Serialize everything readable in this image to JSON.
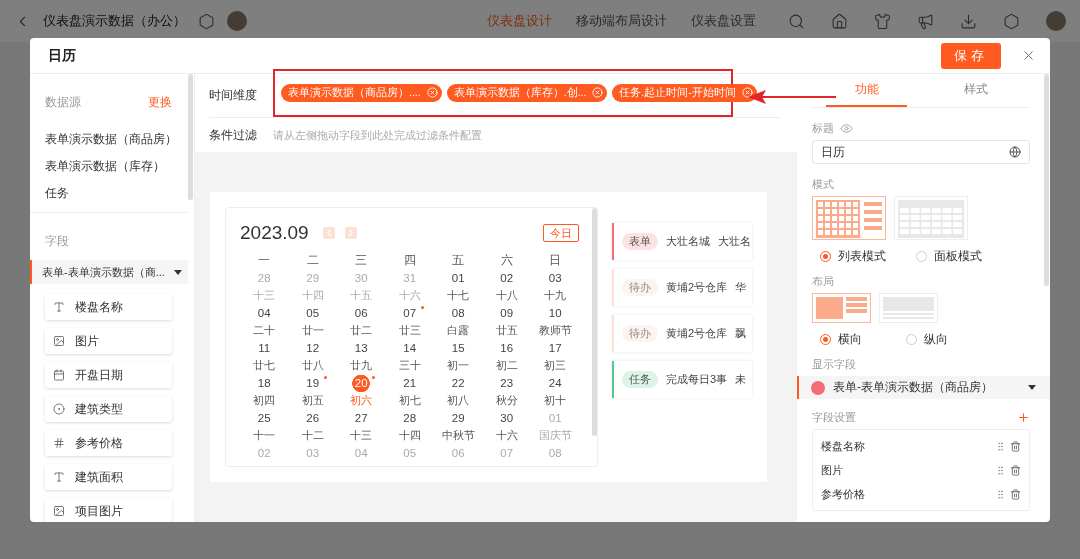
{
  "top_bar": {
    "title": "仪表盘演示数据（办公）",
    "tabs": [
      {
        "label": "仪表盘设计",
        "selected": true
      },
      {
        "label": "移动端布局设计",
        "selected": false
      },
      {
        "label": "仪表盘设置",
        "selected": false
      }
    ]
  },
  "dialog": {
    "title": "日历",
    "save": "保存",
    "left": {
      "source_label": "数据源",
      "change_link": "更换",
      "sources": [
        "表单演示数据（商品房）",
        "表单演示数据（库存）",
        "任务"
      ],
      "field_label": "字段",
      "group": "表单-表单演示数据（商...",
      "fields": [
        {
          "kind": "text",
          "label": "楼盘名称"
        },
        {
          "kind": "image",
          "label": "图片"
        },
        {
          "kind": "date",
          "label": "开盘日期"
        },
        {
          "kind": "radio",
          "label": "建筑类型"
        },
        {
          "kind": "number",
          "label": "参考价格"
        },
        {
          "kind": "text",
          "label": "建筑面积"
        },
        {
          "kind": "image",
          "label": "项目图片"
        }
      ]
    },
    "middle": {
      "time_label": "时间维度",
      "chips": [
        "表单演示数据（商品房）....",
        "表单演示数据（库存）.创...",
        "任务.起止时间-开始时间"
      ],
      "filter_label": "条件过滤",
      "filter_placeholder": "请从左侧拖动字段到此处完成过滤条件配置",
      "calendar": {
        "title": "2023.09",
        "today_button": "今日",
        "weekdays": [
          "一",
          "二",
          "三",
          "四",
          "五",
          "六",
          "日"
        ],
        "weeks": [
          [
            {
              "date": "28",
              "lunar": "十三",
              "outside": true,
              "selected": false,
              "has_event": false
            },
            {
              "date": "29",
              "lunar": "十四",
              "outside": true,
              "selected": false,
              "has_event": false
            },
            {
              "date": "30",
              "lunar": "十五",
              "outside": true,
              "selected": false,
              "has_event": false
            },
            {
              "date": "31",
              "lunar": "十六",
              "outside": true,
              "selected": false,
              "has_event": false
            },
            {
              "date": "01",
              "lunar": "十七",
              "outside": false,
              "selected": false,
              "has_event": false
            },
            {
              "date": "02",
              "lunar": "十八",
              "outside": false,
              "selected": false,
              "has_event": false
            },
            {
              "date": "03",
              "lunar": "十九",
              "outside": false,
              "selected": false,
              "has_event": false
            }
          ],
          [
            {
              "date": "04",
              "lunar": "二十",
              "outside": false,
              "selected": false,
              "has_event": false
            },
            {
              "date": "05",
              "lunar": "廿一",
              "outside": false,
              "selected": false,
              "has_event": false
            },
            {
              "date": "06",
              "lunar": "廿二",
              "outside": false,
              "selected": false,
              "has_event": false
            },
            {
              "date": "07",
              "lunar": "廿三",
              "outside": false,
              "selected": false,
              "has_event": true
            },
            {
              "date": "08",
              "lunar": "白露",
              "outside": false,
              "selected": false,
              "has_event": false
            },
            {
              "date": "09",
              "lunar": "廿五",
              "outside": false,
              "selected": false,
              "has_event": false
            },
            {
              "date": "10",
              "lunar": "教师节",
              "outside": false,
              "selected": false,
              "has_event": false
            }
          ],
          [
            {
              "date": "11",
              "lunar": "廿七",
              "outside": false,
              "selected": false,
              "has_event": false
            },
            {
              "date": "12",
              "lunar": "廿八",
              "outside": false,
              "selected": false,
              "has_event": false
            },
            {
              "date": "13",
              "lunar": "廿九",
              "outside": false,
              "selected": false,
              "has_event": false
            },
            {
              "date": "14",
              "lunar": "三十",
              "outside": false,
              "selected": false,
              "has_event": false
            },
            {
              "date": "15",
              "lunar": "初一",
              "outside": false,
              "selected": false,
              "has_event": false
            },
            {
              "date": "16",
              "lunar": "初二",
              "outside": false,
              "selected": false,
              "has_event": false
            },
            {
              "date": "17",
              "lunar": "初三",
              "outside": false,
              "selected": false,
              "has_event": false
            }
          ],
          [
            {
              "date": "18",
              "lunar": "初四",
              "outside": false,
              "selected": false,
              "has_event": false
            },
            {
              "date": "19",
              "lunar": "初五",
              "outside": false,
              "selected": false,
              "has_event": true
            },
            {
              "date": "20",
              "lunar": "初六",
              "outside": false,
              "selected": true,
              "has_event": true
            },
            {
              "date": "21",
              "lunar": "初七",
              "outside": false,
              "selected": false,
              "has_event": false
            },
            {
              "date": "22",
              "lunar": "初八",
              "outside": false,
              "selected": false,
              "has_event": false
            },
            {
              "date": "23",
              "lunar": "秋分",
              "outside": false,
              "selected": false,
              "has_event": false
            },
            {
              "date": "24",
              "lunar": "初十",
              "outside": false,
              "selected": false,
              "has_event": false
            }
          ],
          [
            {
              "date": "25",
              "lunar": "十一",
              "outside": false,
              "selected": false,
              "has_event": false
            },
            {
              "date": "26",
              "lunar": "十二",
              "outside": false,
              "selected": false,
              "has_event": false
            },
            {
              "date": "27",
              "lunar": "十三",
              "outside": false,
              "selected": false,
              "has_event": false
            },
            {
              "date": "28",
              "lunar": "十四",
              "outside": false,
              "selected": false,
              "has_event": false
            },
            {
              "date": "29",
              "lunar": "中秋节",
              "outside": false,
              "selected": false,
              "has_event": false
            },
            {
              "date": "30",
              "lunar": "十六",
              "outside": false,
              "selected": false,
              "has_event": false
            },
            {
              "date": "01",
              "lunar": "国庆节",
              "outside": true,
              "selected": false,
              "has_event": false
            }
          ],
          [
            {
              "date": "02",
              "outside": true,
              "selected": false,
              "has_event": false
            },
            {
              "date": "03",
              "outside": true,
              "selected": false,
              "has_event": false
            },
            {
              "date": "04",
              "outside": true,
              "selected": false,
              "has_event": false
            },
            {
              "date": "05",
              "outside": true,
              "selected": false,
              "has_event": false
            },
            {
              "date": "06",
              "outside": true,
              "selected": false,
              "has_event": false
            },
            {
              "date": "07",
              "outside": true,
              "selected": false,
              "has_event": false
            },
            {
              "date": "08",
              "outside": true,
              "selected": false,
              "has_event": false
            }
          ]
        ]
      },
      "events": [
        {
          "kind": "form",
          "tag": "表单",
          "title": "大壮名城",
          "detail": "大壮名"
        },
        {
          "kind": "todo",
          "tag": "待办",
          "title": "黄埔2号仓库",
          "detail": "华"
        },
        {
          "kind": "todo",
          "tag": "待办",
          "title": "黄埔2号仓库",
          "detail": "飘"
        },
        {
          "kind": "task",
          "tag": "任务",
          "title": "完成每日3事",
          "detail": "未"
        }
      ]
    },
    "right": {
      "tabs": [
        {
          "label": "功能",
          "selected": true
        },
        {
          "label": "样式",
          "selected": false
        }
      ],
      "title_label": "标题",
      "title_value": "日历",
      "mode_label": "模式",
      "modes": [
        {
          "kind": "list",
          "label": "列表模式",
          "selected": true
        },
        {
          "kind": "panel",
          "label": "面板模式",
          "selected": false
        }
      ],
      "layout_label": "布局",
      "layouts": [
        {
          "kind": "horizontal",
          "label": "横向",
          "selected": true
        },
        {
          "kind": "vertical",
          "label": "纵向",
          "selected": false
        }
      ],
      "display_label": "显示字段",
      "display_field": {
        "label": "表单-表单演示数据（商品房）",
        "color": "#f76b78"
      },
      "settings_label": "字段设置",
      "setting_fields": [
        "楼盘名称",
        "图片",
        "参考价格"
      ]
    }
  }
}
